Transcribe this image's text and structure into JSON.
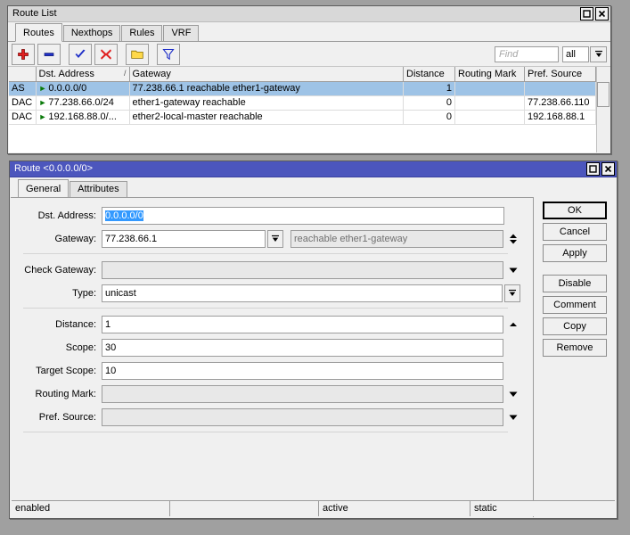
{
  "route_list": {
    "title": "Route List",
    "window_buttons": [
      {
        "name": "maximize-button",
        "glyph": "square"
      },
      {
        "name": "close-button",
        "glyph": "x"
      }
    ],
    "tabs": [
      {
        "label": "Routes",
        "active": true
      },
      {
        "label": "Nexthops",
        "active": false
      },
      {
        "label": "Rules",
        "active": false
      },
      {
        "label": "VRF",
        "active": false
      }
    ],
    "toolbar": [
      {
        "name": "add-button",
        "icon": "plus-icon"
      },
      {
        "name": "remove-button",
        "icon": "minus-icon"
      },
      {
        "name": "enable-button",
        "icon": "check-icon"
      },
      {
        "name": "disable-button",
        "icon": "cross-icon"
      },
      {
        "name": "comment-button",
        "icon": "folder-icon"
      },
      {
        "name": "filter-button",
        "icon": "funnel-icon"
      }
    ],
    "search": {
      "placeholder": "Find",
      "scope_value": "all"
    },
    "columns": [
      "",
      "Dst. Address",
      "Gateway",
      "Distance",
      "Routing Mark",
      "Pref. Source"
    ],
    "sort_indicator": "/",
    "rows": [
      {
        "flags": "AS",
        "dst_address": "0.0.0.0/0",
        "gateway": "77.238.66.1 reachable ether1-gateway",
        "distance": "1",
        "routing_mark": "",
        "pref_source": "",
        "selected": true
      },
      {
        "flags": "DAC",
        "dst_address": "77.238.66.0/24",
        "gateway": "ether1-gateway reachable",
        "distance": "0",
        "routing_mark": "",
        "pref_source": "77.238.66.110",
        "selected": false
      },
      {
        "flags": "DAC",
        "dst_address": "192.168.88.0/...",
        "gateway": "ether2-local-master reachable",
        "distance": "0",
        "routing_mark": "",
        "pref_source": "192.168.88.1",
        "selected": false
      }
    ]
  },
  "route_dialog": {
    "title": "Route <0.0.0.0/0>",
    "title_color": "#4c56bd",
    "window_buttons": [
      {
        "name": "maximize-button",
        "glyph": "square"
      },
      {
        "name": "close-button",
        "glyph": "x"
      }
    ],
    "tabs": [
      {
        "label": "General",
        "active": true
      },
      {
        "label": "Attributes",
        "active": false
      }
    ],
    "fields": {
      "dst_address": {
        "label": "Dst. Address:",
        "value": "0.0.0.0/0",
        "selected": true
      },
      "gateway": {
        "label": "Gateway:",
        "value": "77.238.66.1",
        "status": "reachable ether1-gateway"
      },
      "check_gateway": {
        "label": "Check Gateway:",
        "value": "",
        "disabled": true
      },
      "type": {
        "label": "Type:",
        "value": "unicast"
      },
      "distance": {
        "label": "Distance:",
        "value": "1"
      },
      "scope": {
        "label": "Scope:",
        "value": "30"
      },
      "target_scope": {
        "label": "Target Scope:",
        "value": "10"
      },
      "routing_mark": {
        "label": "Routing Mark:",
        "value": "",
        "disabled": true
      },
      "pref_source": {
        "label": "Pref. Source:",
        "value": "",
        "disabled": true
      }
    },
    "buttons": [
      {
        "label": "OK",
        "focused": true
      },
      {
        "label": "Cancel",
        "focused": false
      },
      {
        "label": "Apply",
        "focused": false
      },
      {
        "label": "Disable",
        "focused": false
      },
      {
        "label": "Comment",
        "focused": false
      },
      {
        "label": "Copy",
        "focused": false
      },
      {
        "label": "Remove",
        "focused": false
      }
    ],
    "status": [
      "enabled",
      "",
      "active",
      "static"
    ]
  }
}
